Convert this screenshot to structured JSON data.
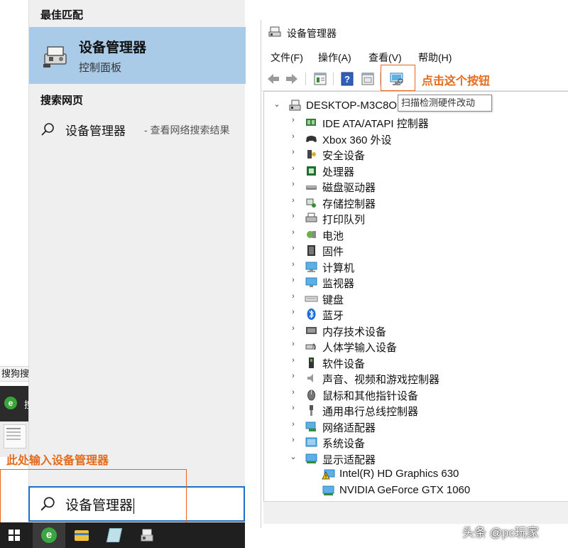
{
  "left_strip": {
    "label": "搜狗搜",
    "mini_item_label": "搜"
  },
  "search_panel": {
    "best_match_heading": "最佳匹配",
    "best_match": {
      "title": "设备管理器",
      "subtitle": "控制面板"
    },
    "web_heading": "搜索网页",
    "web_item": {
      "title": "设备管理器",
      "subtitle": " - 查看网络搜索结果"
    },
    "annotation": "此处输入设备管理器",
    "search_value": "设备管理器"
  },
  "taskbar": {
    "items": [
      "windows-start",
      "internet-explorer",
      "file-explorer",
      "notes-app",
      "device-manager"
    ]
  },
  "device_manager": {
    "title": "设备管理器",
    "menu": [
      "文件(F)",
      "操作(A)",
      "查看(V)",
      "帮助(H)"
    ],
    "toolbar_icons": [
      "back-arrow-icon",
      "forward-arrow-icon",
      "properties-icon",
      "help-icon",
      "view-icon",
      "scan-hardware-icon"
    ],
    "annotation": "点击这个按钮",
    "tooltip": "扫描检测硬件改动",
    "root": "DESKTOP-M3C8O",
    "categories": [
      {
        "label": "IDE ATA/ATAPI 控制器",
        "icon": "ide-icon"
      },
      {
        "label": "Xbox 360 外设",
        "icon": "gamepad-icon"
      },
      {
        "label": "安全设备",
        "icon": "security-icon"
      },
      {
        "label": "处理器",
        "icon": "cpu-icon"
      },
      {
        "label": "磁盘驱动器",
        "icon": "disk-icon"
      },
      {
        "label": "存储控制器",
        "icon": "storage-icon"
      },
      {
        "label": "打印队列",
        "icon": "printer-icon"
      },
      {
        "label": "电池",
        "icon": "battery-icon"
      },
      {
        "label": "固件",
        "icon": "firmware-icon"
      },
      {
        "label": "计算机",
        "icon": "computer-icon"
      },
      {
        "label": "监视器",
        "icon": "monitor-icon"
      },
      {
        "label": "键盘",
        "icon": "keyboard-icon"
      },
      {
        "label": "蓝牙",
        "icon": "bluetooth-icon"
      },
      {
        "label": "内存技术设备",
        "icon": "memory-icon"
      },
      {
        "label": "人体学输入设备",
        "icon": "hid-icon"
      },
      {
        "label": "软件设备",
        "icon": "software-icon"
      },
      {
        "label": "声音、视频和游戏控制器",
        "icon": "speaker-icon"
      },
      {
        "label": "鼠标和其他指针设备",
        "icon": "mouse-icon"
      },
      {
        "label": "通用串行总线控制器",
        "icon": "usb-icon"
      },
      {
        "label": "网络适配器",
        "icon": "network-icon"
      },
      {
        "label": "系统设备",
        "icon": "system-icon"
      },
      {
        "label": "显示适配器",
        "icon": "display-icon"
      }
    ],
    "display_children": [
      {
        "label": "Intel(R) HD Graphics 630",
        "icon": "warning-display-icon"
      },
      {
        "label": "NVIDIA GeForce GTX 1060",
        "icon": "display-icon"
      }
    ]
  },
  "watermark": "头条 @pc玩家",
  "colors": {
    "accent_orange": "#e66a1a",
    "selection_blue": "#a9cbe8",
    "focus_blue": "#1e6fc9"
  }
}
